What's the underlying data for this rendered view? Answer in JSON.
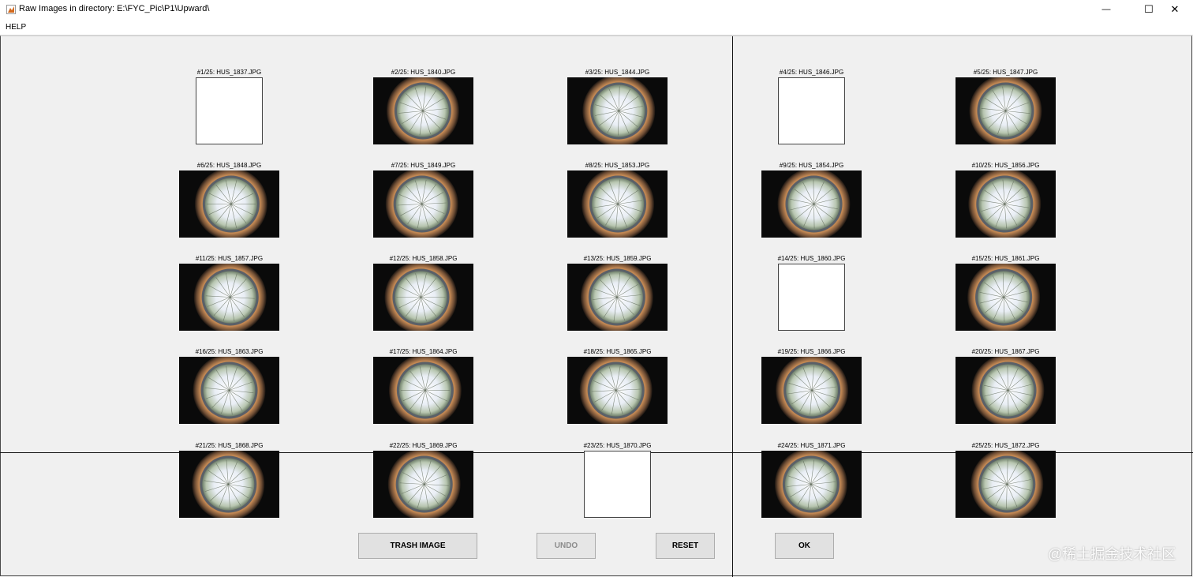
{
  "window": {
    "title": "Raw Images in directory: E:\\FYC_Pic\\P1\\Upward\\",
    "minimize_glyph": "—",
    "maximize_glyph": "☐",
    "close_glyph": "✕"
  },
  "menu": {
    "help": "HELP"
  },
  "images": [
    {
      "label": "#1/25: HUS_1837.JPG",
      "blank": true
    },
    {
      "label": "#2/25: HUS_1840.JPG",
      "blank": false
    },
    {
      "label": "#3/25: HUS_1844.JPG",
      "blank": false
    },
    {
      "label": "#4/25: HUS_1846.JPG",
      "blank": true
    },
    {
      "label": "#5/25: HUS_1847.JPG",
      "blank": false
    },
    {
      "label": "#6/25: HUS_1848.JPG",
      "blank": false
    },
    {
      "label": "#7/25: HUS_1849.JPG",
      "blank": false
    },
    {
      "label": "#8/25: HUS_1853.JPG",
      "blank": false
    },
    {
      "label": "#9/25: HUS_1854.JPG",
      "blank": false
    },
    {
      "label": "#10/25: HUS_1856.JPG",
      "blank": false
    },
    {
      "label": "#11/25: HUS_1857.JPG",
      "blank": false
    },
    {
      "label": "#12/25: HUS_1858.JPG",
      "blank": false
    },
    {
      "label": "#13/25: HUS_1859.JPG",
      "blank": false
    },
    {
      "label": "#14/25: HUS_1860.JPG",
      "blank": true
    },
    {
      "label": "#15/25: HUS_1861.JPG",
      "blank": false
    },
    {
      "label": "#16/25: HUS_1863.JPG",
      "blank": false
    },
    {
      "label": "#17/25: HUS_1864.JPG",
      "blank": false
    },
    {
      "label": "#18/25: HUS_1865.JPG",
      "blank": false
    },
    {
      "label": "#19/25: HUS_1866.JPG",
      "blank": false
    },
    {
      "label": "#20/25: HUS_1867.JPG",
      "blank": false
    },
    {
      "label": "#21/25: HUS_1868.JPG",
      "blank": false
    },
    {
      "label": "#22/25: HUS_1869.JPG",
      "blank": false
    },
    {
      "label": "#23/25: HUS_1870.JPG",
      "blank": true
    },
    {
      "label": "#24/25: HUS_1871.JPG",
      "blank": false
    },
    {
      "label": "#25/25: HUS_1872.JPG",
      "blank": false
    }
  ],
  "buttons": {
    "trash": "TRASH IMAGE",
    "undo": "UNDO",
    "reset": "RESET",
    "ok": "OK"
  },
  "watermark": "@稀土掘金技术社区",
  "icons": {
    "app": "matlab-figure-icon",
    "minimize": "minimize-icon",
    "maximize": "maximize-icon",
    "close": "close-icon"
  }
}
